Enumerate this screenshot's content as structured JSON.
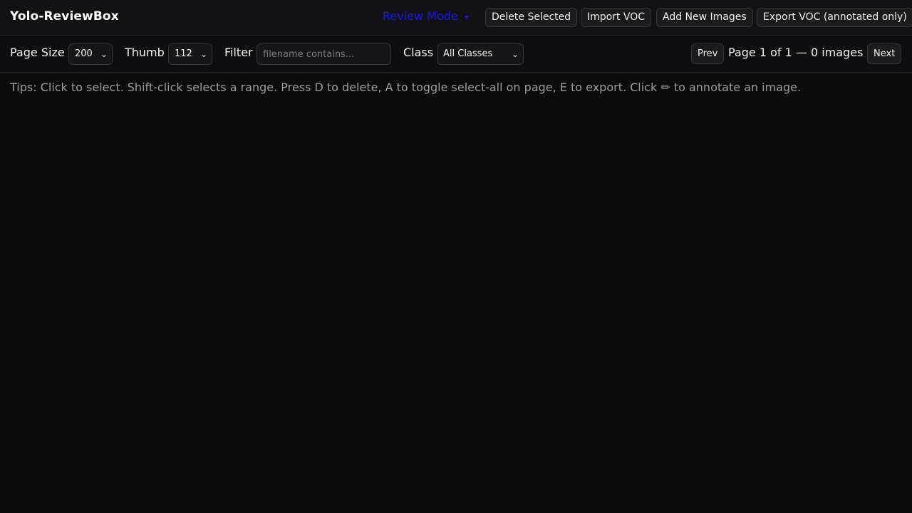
{
  "header": {
    "title": "Yolo-ReviewBox",
    "mode_label": "Review Mode",
    "mode_chevron": "▾",
    "buttons": {
      "delete": "Delete Selected",
      "import": "Import VOC",
      "add": "Add New Images",
      "export": "Export VOC (annotated only)"
    }
  },
  "toolbar": {
    "page_size_label": "Page Size",
    "page_size_value": "200",
    "thumb_label": "Thumb",
    "thumb_value": "112",
    "filter_label": "Filter",
    "filter_placeholder": "filename contains...",
    "filter_value": "",
    "class_label": "Class",
    "class_value": "All Classes",
    "prev_label": "Prev",
    "next_label": "Next",
    "page_info": "Page 1 of 1 — 0 images"
  },
  "tips": "Tips: Click to select. Shift-click selects a range. Press D to delete, A to toggle select-all on page, E to export. Click ✏ to annotate an image.",
  "icons": {
    "select_chevron": "chevron-down-icon",
    "annotate": "pencil-icon"
  },
  "colors": {
    "background": "#0b0b0c",
    "mode_link": "#1a1adf"
  }
}
